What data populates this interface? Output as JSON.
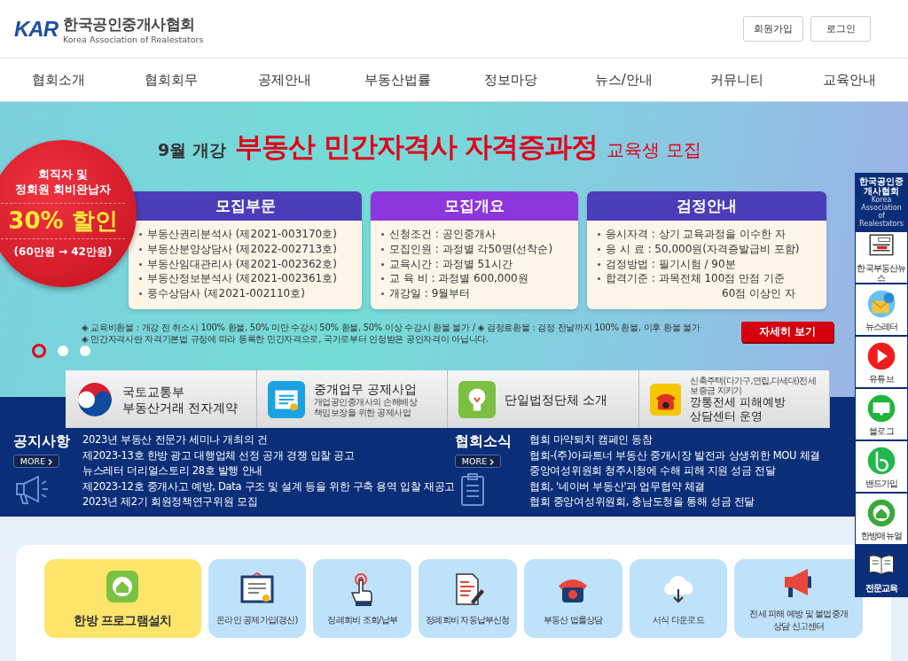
{
  "header": {
    "logo": {
      "mark": "KAR",
      "name": "한국공인중개사협회",
      "name_en": "Korea Association of Realestators"
    },
    "buttons": [
      "회원가입",
      "로그인"
    ]
  },
  "nav": {
    "items": [
      "협회소개",
      "협회회무",
      "공제안내",
      "부동산법률",
      "정보마당",
      "뉴스/안내",
      "커뮤니티",
      "교육안내"
    ]
  },
  "banner": {
    "badge": {
      "lines": [
        "회직자 및",
        "정회원 회비완납자"
      ],
      "discount": "30% 할인",
      "price": "(60만원 → 42만원)"
    },
    "title": {
      "prefix": "9월 개강",
      "main": "부동산 민간자격사 자격증과정",
      "suffix": "교육생 모집"
    },
    "cards": [
      {
        "title": "모집부문",
        "color": "#4b3db8",
        "items": [
          {
            "kind": "bullet",
            "text": "부동산권리분석사 (제2021-003170호)"
          },
          {
            "kind": "bullet",
            "text": "부동산분양상담사 (제2022-002713호)"
          },
          {
            "kind": "bullet",
            "text": "부동산임대관리사 (제2021-002362호)"
          },
          {
            "kind": "bullet",
            "text": "부동산정보분석사 (제2021-002361호)"
          },
          {
            "kind": "bullet",
            "text": "풍수상담사 (제2021-002110호)"
          }
        ]
      },
      {
        "title": "모집개요",
        "color": "#8c36dc",
        "items": [
          {
            "kind": "bullet",
            "text": "신청조건 : 공인중개사"
          },
          {
            "kind": "bullet",
            "text": "모집인원 : 과정별 각50명(선착순)"
          },
          {
            "kind": "bullet",
            "text": "교육시간 : 과정별 51시간"
          },
          {
            "kind": "bullet",
            "text": "교 육 비  : 과정별 600,000원"
          },
          {
            "kind": "bullet",
            "text": "개강일 : 9월부터"
          }
        ]
      },
      {
        "title": "검정안내",
        "color": "#4b3db8",
        "items": [
          {
            "kind": "bullet",
            "text": "응시자격 : 상기 교육과정을 이수한 자"
          },
          {
            "kind": "bullet",
            "text": "응 시 료  : 50,000원(자격증발급비 포함)"
          },
          {
            "kind": "bullet",
            "text": "검정방법 : 필기시험 / 90분"
          },
          {
            "kind": "bullet",
            "text": "합격기준 : 과목전체 100점 만점 기준"
          },
          {
            "kind": "continuation",
            "text": "60점 이상인 자"
          }
        ]
      }
    ],
    "notes": [
      "◈ 교육비환불 : 개강 전 취소시 100%  환불, 50% 미만 수강시 50%  환불, 50% 이상 수강시 환불 불가 / ◈ 검정료환불 : 검정 전날까지 100% 환불, 이후 환불 불가",
      "◈ 민간자격사란 자격기본법 규정에 따라 등록한 민간자격으로, 국가로부터 인정받은 공인자격이 아닙니다."
    ],
    "button": "자세히 보기",
    "dots": [
      {
        "selected": true
      },
      {
        "selected": false
      },
      {
        "selected": false
      }
    ]
  },
  "quick_links": [
    {
      "kind": "emblem",
      "lines": [
        "국토교통부",
        "부동산거래 전자계약"
      ]
    },
    {
      "kind": "certificate",
      "lines": [
        "중개업무 공제사업"
      ],
      "sub_lines": [
        "개업공인중개사의 손해배상",
        "책임보장을 위한 공제사업"
      ]
    },
    {
      "kind": "bulb",
      "lines": [
        "단일법정단체 소개"
      ]
    },
    {
      "kind": "phone",
      "caption": "신축주택(다가구,연립,다세대)전세보증금 지키기",
      "lines": [
        "깡통전세 피해예방",
        "상담센터 운영"
      ]
    }
  ],
  "notices": [
    {
      "kind": "megaphone",
      "title": "공지사항",
      "more": "MORE",
      "items": [
        "2023년 부동산 전문가 세미나 개최의 건",
        "제2023-13호 한방 광고 대행업체 선정 공개 경쟁 입찰 공고",
        "뉴스레터 더리얼스토리 28호 발행 안내",
        "제2023-12호 중개사고 예방, Data 구조 및 설계 등을 위한 구축 용역 입찰 재공고",
        "2023년 제2기 회원정책연구위원 모집"
      ]
    },
    {
      "kind": "clipboard",
      "title": "협회소식",
      "more": "MORE",
      "items": [
        "협회 마약퇴치 캠페인 동참",
        "협회-(주)아파트너 부동산 중개시장 발전과 상생위한 MOU 체결",
        "중앙여성위원회 청주시청에 수해 피해 지원 성금 전달",
        "협회, '네이버 부동산'과 업무협약 체결",
        "협회 중앙여성위원회, 충남도청을 통해 성금 전달"
      ]
    }
  ],
  "sidebar": {
    "title": "한국공인중개사협회",
    "subtitle": "Korea Association of Realestators",
    "items": [
      {
        "kind": "newspaper",
        "label": "한국부동산뉴스",
        "highlighted": false
      },
      {
        "kind": "envelope",
        "label": "뉴스레터",
        "highlighted": false
      },
      {
        "kind": "play",
        "label": "유튜브",
        "highlighted": false
      },
      {
        "kind": "blog",
        "label": "블로그",
        "highlighted": false
      },
      {
        "kind": "band",
        "label": "밴드가입",
        "highlighted": false
      },
      {
        "kind": "house",
        "label": "한방매뉴얼",
        "highlighted": false
      },
      {
        "kind": "book",
        "label": "전문교육",
        "highlighted": true
      }
    ]
  },
  "services": [
    {
      "kind": "app",
      "label": "한방 프로그램설치",
      "featured": true
    },
    {
      "kind": "certificate",
      "label": "온라인 공제가입(갱신)",
      "featured": false
    },
    {
      "kind": "tap",
      "label": "정례회비 조회/납부",
      "featured": false
    },
    {
      "kind": "document",
      "label": "정례회비 자동납부신청",
      "featured": false
    },
    {
      "kind": "phone",
      "label": "부동산 법률상담",
      "featured": false
    },
    {
      "kind": "cloud",
      "label": "서식 다운로드",
      "featured": false
    },
    {
      "kind": "megaphone",
      "label": "전세 피해 예방 및 불법중개 상담 신고센터",
      "featured": false
    }
  ]
}
